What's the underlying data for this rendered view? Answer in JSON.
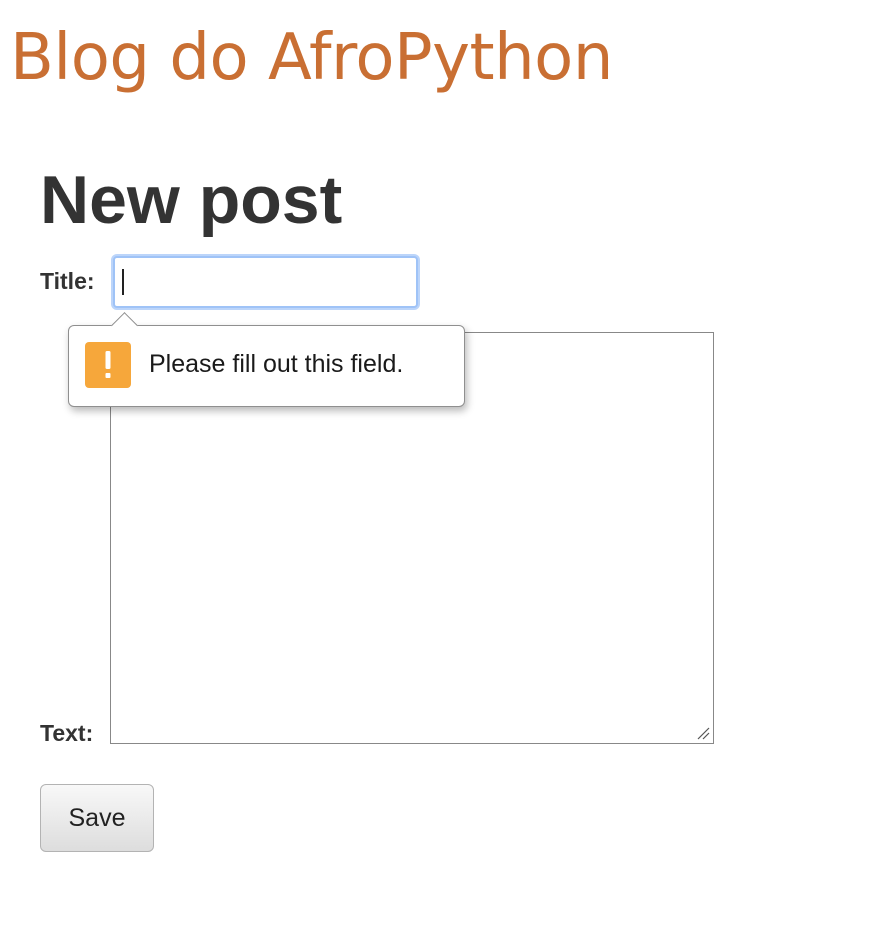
{
  "header": {
    "blog_title": "Blog do AfroPython"
  },
  "form": {
    "heading": "New post",
    "title_label": "Title:",
    "title_value": "",
    "text_label": "Text:",
    "text_value": "",
    "save_label": "Save"
  },
  "validation": {
    "message": "Please fill out this field.",
    "icon": "exclamation-warning-icon",
    "icon_color": "#f6a73b"
  },
  "colors": {
    "brand": "#c96f33",
    "heading": "#333333",
    "focus_ring": "#9fc3f7"
  }
}
